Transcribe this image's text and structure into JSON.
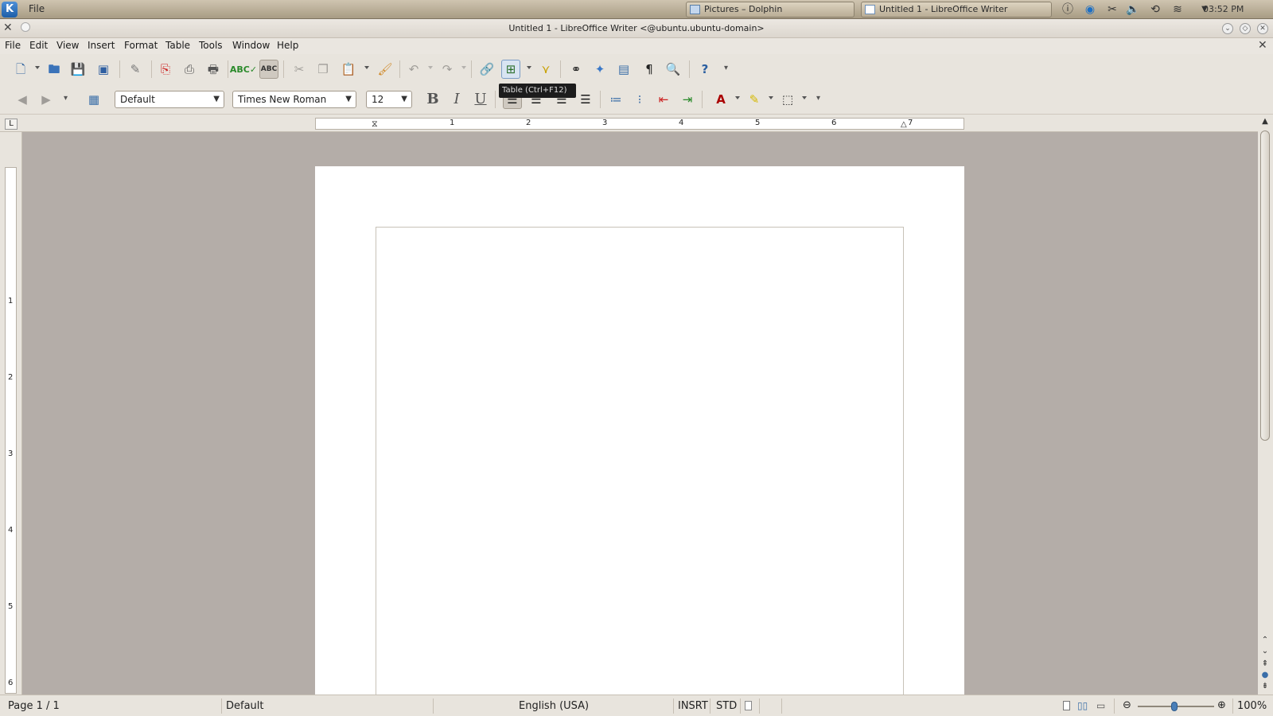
{
  "panel": {
    "menu_label": "File",
    "tasks": [
      {
        "label": "Pictures – Dolphin"
      },
      {
        "label": "Untitled 1 - LibreOffice Writer"
      }
    ],
    "clock": "03:52 PM"
  },
  "window": {
    "title": "Untitled 1 - LibreOffice Writer <@ubuntu.ubuntu-domain>"
  },
  "menubar": {
    "items": [
      "File",
      "Edit",
      "View",
      "Insert",
      "Format",
      "Table",
      "Tools",
      "Window",
      "Help"
    ]
  },
  "toolbar": {
    "tooltip": "Table (Ctrl+F12)"
  },
  "formatting": {
    "paragraph_style": "Default",
    "font_name": "Times New Roman",
    "font_size": "12"
  },
  "ruler": {
    "h_numbers": [
      "1",
      "2",
      "3",
      "4",
      "5",
      "6",
      "7"
    ],
    "v_numbers": [
      "1",
      "2",
      "3",
      "4",
      "5",
      "6"
    ]
  },
  "statusbar": {
    "page": "Page 1 / 1",
    "page_style": "Default",
    "language": "English (USA)",
    "insert_mode": "INSRT",
    "selection_mode": "STD",
    "zoom": "100%"
  },
  "colors": {
    "panel": "#b9ad95",
    "document_bg": "#b4ada8",
    "page": "#ffffff",
    "accent": "#1d5ea8"
  }
}
